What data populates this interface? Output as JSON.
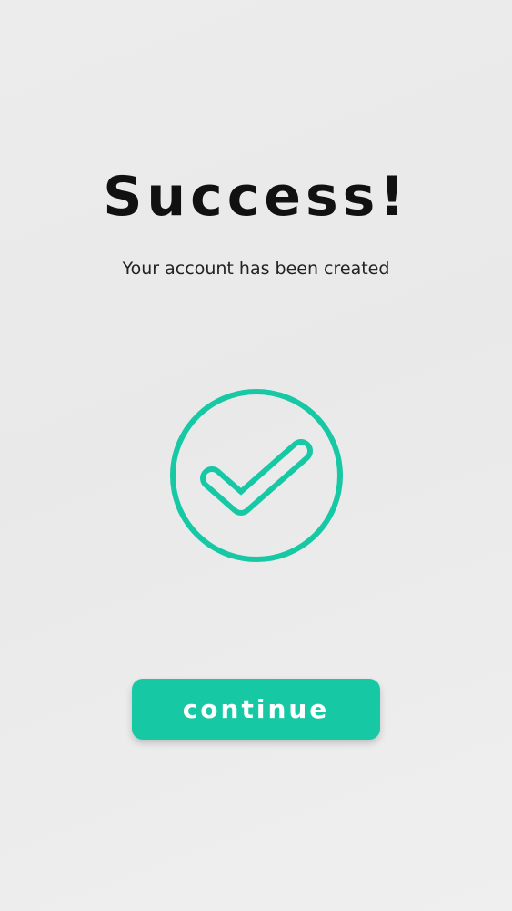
{
  "screen": {
    "title": "Success!",
    "message": "Your account has been created",
    "continue_label": "continue",
    "icon": "check-circle-icon"
  },
  "colors": {
    "accent": "#16c9a4",
    "title": "#111111",
    "message": "#222222",
    "background": "#ececec",
    "button_text": "#ffffff"
  }
}
